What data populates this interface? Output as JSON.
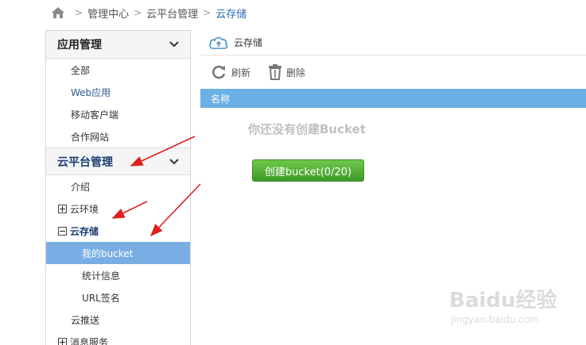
{
  "breadcrumb": {
    "items": [
      "管理中心",
      "云平台管理",
      "云存储"
    ]
  },
  "sidebar": {
    "group1": {
      "title": "应用管理",
      "items": [
        "全部",
        "Web应用",
        "移动客户端",
        "合作网站"
      ]
    },
    "group2": {
      "title": "云平台管理",
      "items": [
        "介绍",
        "云环境",
        "云存储",
        "我的bucket",
        "统计信息",
        "URL签名",
        "云推送",
        "消息服务"
      ]
    }
  },
  "main": {
    "panel_title": "云存储",
    "toolbar": {
      "refresh_label": "刷新",
      "delete_label": "删除"
    },
    "table": {
      "column_name": "名称"
    },
    "empty_message": "你还没有创建Bucket",
    "create_button": "创建bucket(0/20)"
  },
  "watermark": {
    "brand": "Baidu经验",
    "url": "jingyan.baidu.com"
  },
  "colors": {
    "accent_blue": "#6ab0e6",
    "active_item": "#78aee3",
    "button_green": "#4caf32",
    "annotation_red": "#e02020"
  }
}
